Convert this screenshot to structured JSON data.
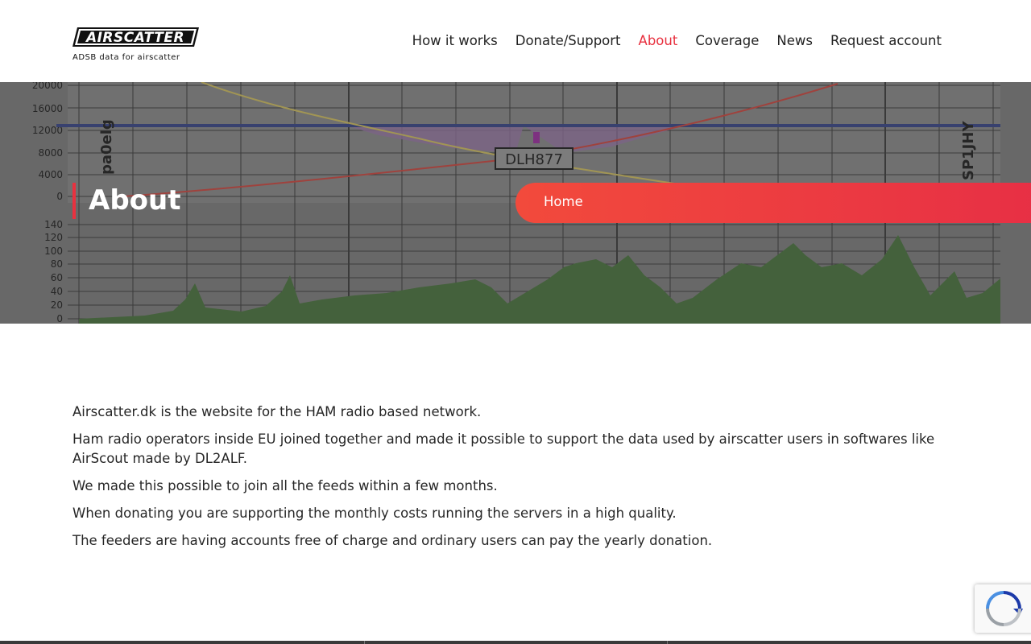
{
  "header": {
    "logo_text": "AIRSCATTER",
    "tagline": "ADSB data for airscatter",
    "nav": [
      {
        "label": "How it works",
        "active": false
      },
      {
        "label": "Donate/Support",
        "active": false
      },
      {
        "label": "About",
        "active": true
      },
      {
        "label": "Coverage",
        "active": false
      },
      {
        "label": "News",
        "active": false
      },
      {
        "label": "Request account",
        "active": false
      }
    ]
  },
  "hero": {
    "title": "About",
    "breadcrumb_home": "Home",
    "background_chart": {
      "left_label": "pa0elg",
      "right_label": "SP1JHY",
      "flight_label": "DLH877",
      "upper_ticks": [
        "20000",
        "16000",
        "12000",
        "8000",
        "4000",
        "0"
      ],
      "lower_ticks": [
        "140",
        "120",
        "100",
        "80",
        "60",
        "40",
        "20",
        "0"
      ]
    }
  },
  "content": {
    "paragraphs": [
      "Airscatter.dk is the website for the HAM radio based network.",
      "Ham radio operators inside EU joined together and made it possible to support the data used by airscatter users in softwares like AirScout made by DL2ALF.",
      "We made this possible to join all the feeds within a few months.",
      "When donating you are supporting the monthly costs running the servers in a high quality.",
      "The feeders are having accounts free of charge and ordinary users can pay the yearly donation."
    ]
  },
  "colors": {
    "accent": "#e8313f",
    "gradient_start": "#f24a3c",
    "gradient_end": "#e72f45"
  }
}
